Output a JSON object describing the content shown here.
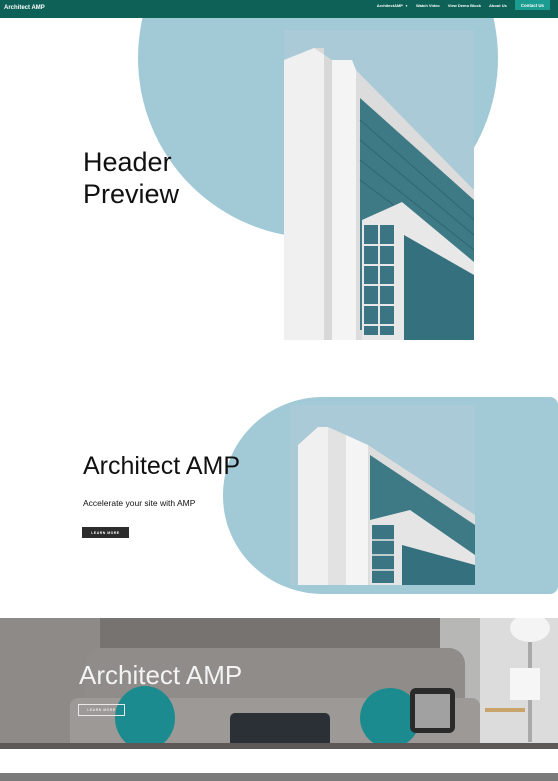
{
  "nav": {
    "brand": "Architect AMP",
    "links": [
      "ArchitectAMP",
      "Watch Video",
      "View Demo Block",
      "About Us"
    ],
    "cta": "Contact Us"
  },
  "section1": {
    "title_line1": "Header",
    "title_line2": "Preview"
  },
  "section2": {
    "title": "Architect AMP",
    "subtitle": "Accelerate your site with AMP",
    "button": "LEARN MORE"
  },
  "section3": {
    "title": "Architect AMP",
    "button": "LEARN MORE"
  },
  "colors": {
    "nav_bg": "#0d6157",
    "accent": "#1a9d90",
    "shape": "#a1c9d6",
    "button_dark": "#2c2c2c"
  },
  "icons": {
    "caret": "chevron-down-icon"
  }
}
